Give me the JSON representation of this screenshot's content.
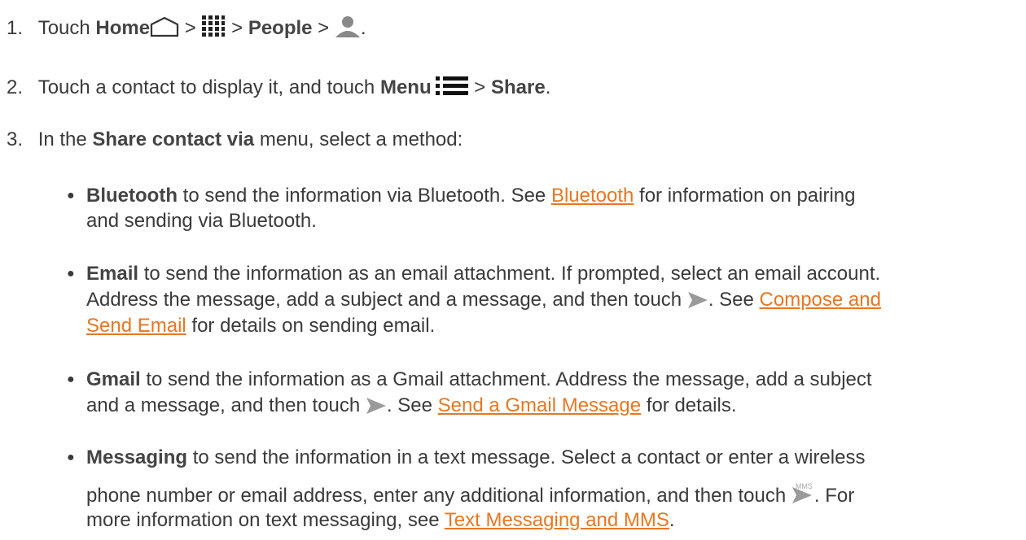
{
  "steps": [
    {
      "num": "1.",
      "pre": "Touch ",
      "home": "Home",
      "sep1": " > ",
      "sep2": " > ",
      "people": "People",
      "sep3": " > ",
      "end": "."
    },
    {
      "num": "2.",
      "pre": "Touch a contact to display it, and touch ",
      "menu": "Menu",
      "sep": " > ",
      "share": "Share",
      "end": "."
    },
    {
      "num": "3.",
      "pre": "In the ",
      "share_via": "Share contact via",
      "post": " menu, select a method:"
    }
  ],
  "bullets": {
    "bluetooth": {
      "term": "Bluetooth",
      "text1": " to send the information via Bluetooth. See ",
      "link": "Bluetooth",
      "text2": " for information on pairing",
      "line2": "and sending via Bluetooth."
    },
    "email": {
      "term": "Email",
      "text1": " to send the information as an email attachment. If prompted, select an email account.",
      "line2": "Address the message, add a subject and a message, and then touch ",
      "line2b": ". See ",
      "link_a": "Compose and",
      "link_b": "Send Email",
      "line3": " for details on sending email."
    },
    "gmail": {
      "term": "Gmail",
      "text1": " to send the information as a Gmail attachment. Address the message, add a subject",
      "line2": "and a message, and then touch ",
      "line2b": ". See ",
      "link": "Send a Gmail Message",
      "line2c": " for details."
    },
    "messaging": {
      "term": "Messaging",
      "text1": " to send the information in a text message. Select a contact or enter a wireless",
      "line2": "phone number or email address, enter any additional information, and then touch ",
      "line2b": ". For",
      "line3": "more information on text messaging, see ",
      "link": "Text Messaging and MMS",
      "line3b": ".",
      "mms_label": "MMS"
    }
  },
  "icons": [
    "home-icon",
    "apps-grid-icon",
    "person-icon",
    "menu-icon",
    "send-icon"
  ]
}
